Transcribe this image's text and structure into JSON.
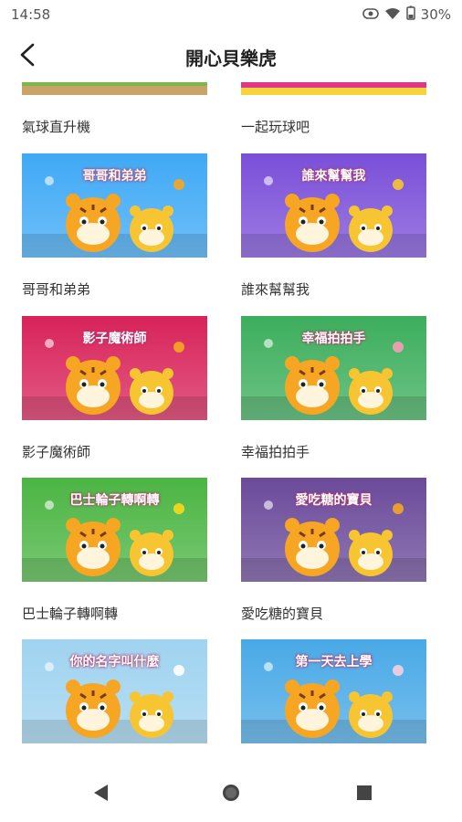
{
  "status": {
    "time": "14:58",
    "battery": "30%"
  },
  "header": {
    "title": "開心貝樂虎"
  },
  "top_partial_labels": [
    "氣球直升機",
    "一起玩球吧"
  ],
  "cards": [
    {
      "label": "哥哥和弟弟",
      "badge": "哥哥和弟弟",
      "bg": "#3fa9f5",
      "accent": "#f6a623"
    },
    {
      "label": "誰來幫幫我",
      "badge": "誰來幫幫我",
      "bg": "#7a4fd8",
      "accent": "#f7c531"
    },
    {
      "label": "影子魔術師",
      "badge": "影子魔術師",
      "bg": "#d8235a",
      "accent": "#f6a623"
    },
    {
      "label": "幸福拍拍手",
      "badge": "幸福拍拍手",
      "bg": "#3cae5c",
      "accent": "#f3a0b5"
    },
    {
      "label": "巴士輪子轉啊轉",
      "badge": "巴士輪子轉啊轉",
      "bg": "#4bb543",
      "accent": "#f9d81b"
    },
    {
      "label": "愛吃糖的寶貝",
      "badge": "愛吃糖的寶貝",
      "bg": "#6a4a9a",
      "accent": "#f6a623"
    },
    {
      "label": "",
      "badge": "你的名字叫什麼",
      "bg": "#9fd3f0",
      "accent": "#ffffff"
    },
    {
      "label": "",
      "badge": "第一天去上學",
      "bg": "#49a9e6",
      "accent": "#f5d0e0"
    }
  ],
  "colors": {
    "title_text": "#222222",
    "label_text": "#333333",
    "nav_icon": "#444444"
  }
}
